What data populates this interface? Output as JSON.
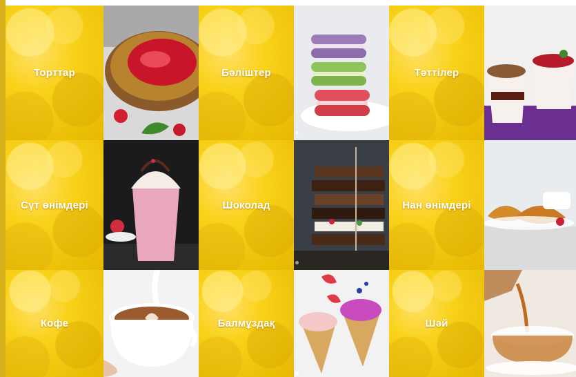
{
  "categories": [
    {
      "label": "Торттар"
    },
    {
      "label": "Бәліштер"
    },
    {
      "label": "Тәттілер"
    },
    {
      "label": "Сүт өнімдері"
    },
    {
      "label": "Шоколад"
    },
    {
      "label": "Нан өнімдері"
    },
    {
      "label": "Кофе"
    },
    {
      "label": "Балмұздақ"
    },
    {
      "label": "Шәй"
    }
  ],
  "photos": [
    {
      "icon": "cake-photo"
    },
    {
      "icon": "macarons-photo"
    },
    {
      "icon": "dessert-cup-photo"
    },
    {
      "icon": "milkshake-photo"
    },
    {
      "icon": "chocolate-stack-photo"
    },
    {
      "icon": "croissants-photo"
    },
    {
      "icon": "coffee-cup-photo"
    },
    {
      "icon": "ice-cream-cones-photo"
    },
    {
      "icon": "tea-pour-photo"
    }
  ],
  "colors": {
    "accent": "#f5cc14",
    "label": "#ffffff"
  }
}
